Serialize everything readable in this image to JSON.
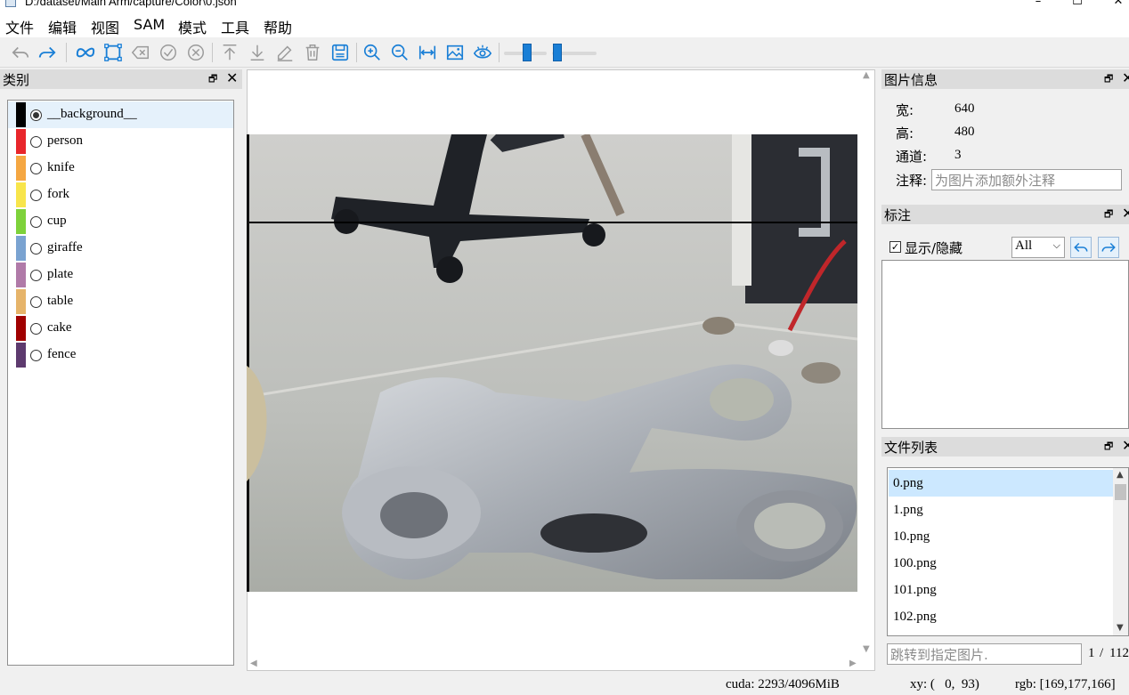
{
  "window": {
    "title": "D:/dataset/Main Arm/capture/Color\\0.json",
    "controls": {
      "minimize": "–",
      "maximize": "☐",
      "close": "✕"
    }
  },
  "menu": [
    "文件",
    "编辑",
    "视图",
    "SAM",
    "模式",
    "工具",
    "帮助"
  ],
  "toolbar": {
    "icons": [
      "undo-icon",
      "redo-icon",
      "sam-icon",
      "polygon-icon",
      "backspace-icon",
      "finish-icon",
      "cancel-icon",
      "move-top-icon",
      "move-bottom-icon",
      "edit-icon",
      "delete-icon",
      "save-icon",
      "zoom-in-icon",
      "zoom-out-icon",
      "fit-width-icon",
      "image-icon",
      "visibility-icon"
    ],
    "accent": "#1a7fd6"
  },
  "category_panel": {
    "title": "类别",
    "float_glyph": "🗗",
    "close_glyph": "✕",
    "items": [
      {
        "label": "__background__",
        "color": "#000000",
        "checked": true
      },
      {
        "label": "person",
        "color": "#e8262b",
        "checked": false
      },
      {
        "label": "knife",
        "color": "#f5a742",
        "checked": false
      },
      {
        "label": "fork",
        "color": "#f8e54b",
        "checked": false
      },
      {
        "label": "cup",
        "color": "#7ed23b",
        "checked": false
      },
      {
        "label": "giraffe",
        "color": "#7aa3d1",
        "checked": false
      },
      {
        "label": "plate",
        "color": "#b07aa8",
        "checked": false
      },
      {
        "label": "table",
        "color": "#e6b46a",
        "checked": false
      },
      {
        "label": "cake",
        "color": "#a00000",
        "checked": false
      },
      {
        "label": "fence",
        "color": "#5d3a6e",
        "checked": false
      }
    ]
  },
  "image_info": {
    "title": "图片信息",
    "width_label": "宽:",
    "width_value": "640",
    "height_label": "高:",
    "height_value": "480",
    "channels_label": "通道:",
    "channels_value": "3",
    "note_label": "注释:",
    "note_placeholder": "为图片添加额外注释"
  },
  "annotation_panel": {
    "title": "标注",
    "toggle_label": "显示/隐藏",
    "toggle_checked": true,
    "filter_value": "All"
  },
  "file_panel": {
    "title": "文件列表",
    "files": [
      "0.png",
      "1.png",
      "10.png",
      "100.png",
      "101.png",
      "102.png"
    ],
    "selected_index": 0,
    "jump_placeholder": "跳转到指定图片.",
    "page_current": "1",
    "page_sep": "/",
    "page_total": "112"
  },
  "status": {
    "cuda": "cuda: 2293/4096MiB",
    "xy": "xy: (   0,  93)",
    "rgb": "rgb: [169,177,166]"
  }
}
